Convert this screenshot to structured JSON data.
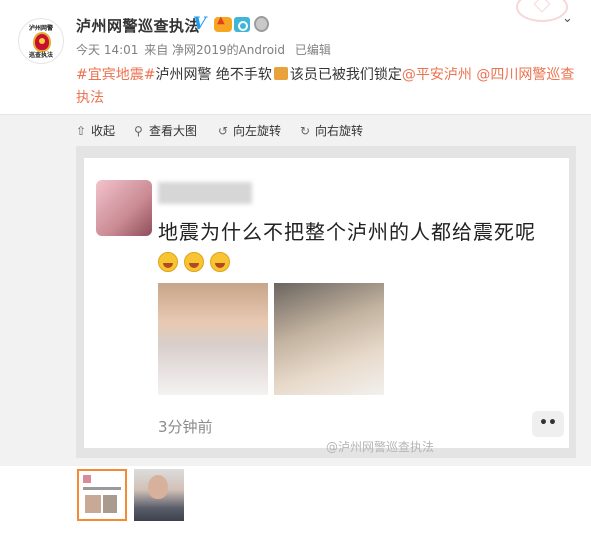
{
  "post": {
    "author_name": "泸州网警巡查执法",
    "avatar_text_top": "泸州网警",
    "avatar_text_bottom": "巡查执法",
    "verified_mark": "V",
    "time": "今天 14:01",
    "source": "来自 净网2019的Android",
    "edited": "已编辑",
    "text_parts": [
      {
        "text": "#宜宾地震#",
        "link": true
      },
      {
        "text": "泸州网警 绝不手软",
        "link": false
      },
      {
        "text": "该员已被我们锁定",
        "link": false
      },
      {
        "text": "@平安泸州",
        "link": true
      },
      {
        "text": " ",
        "link": false
      },
      {
        "text": "@四川网警巡查执法",
        "link": true
      }
    ]
  },
  "toolbar": {
    "collapse": "收起",
    "view_large": "查看大图",
    "rotate_left": "向左旋转",
    "rotate_right": "向右旋转"
  },
  "screenshot": {
    "text": "地震为什么不把整个泸州的人都给震死呢",
    "time": "3分钟前",
    "more": "••",
    "watermark": "@泸州网警巡查执法"
  },
  "colors": {
    "link": "#eb7350",
    "verified": "#1a9cf3",
    "thumb_selected": "#f58a35"
  }
}
